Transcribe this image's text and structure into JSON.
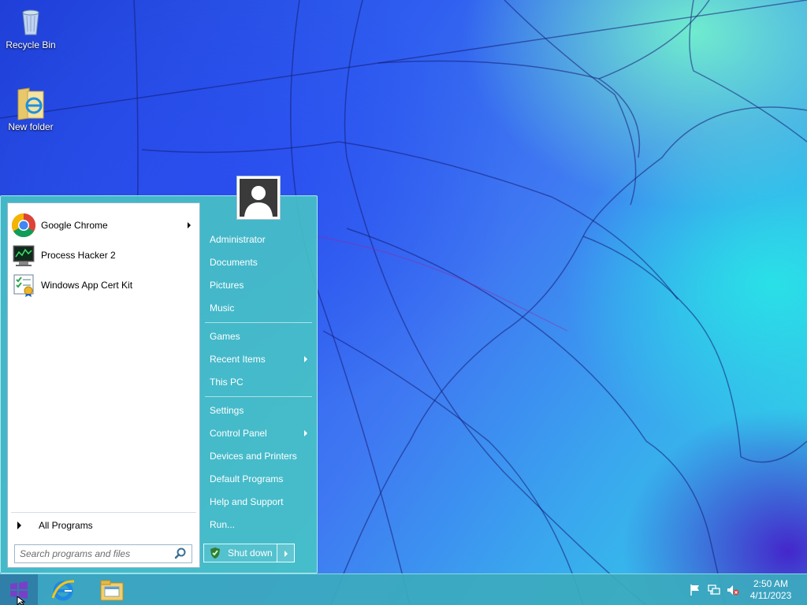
{
  "desktop": {
    "icons": [
      {
        "label": "Recycle Bin",
        "icon": "recycle-bin-icon"
      },
      {
        "label": "New folder",
        "icon": "folder-icon"
      }
    ]
  },
  "start_menu": {
    "programs": [
      {
        "label": "Google Chrome",
        "icon": "chrome-icon",
        "has_submenu": true
      },
      {
        "label": "Process Hacker 2",
        "icon": "process-hacker-icon",
        "has_submenu": false
      },
      {
        "label": "Windows App Cert Kit",
        "icon": "app-cert-kit-icon",
        "has_submenu": false
      }
    ],
    "all_programs_label": "All Programs",
    "search": {
      "placeholder": "Search programs and files",
      "value": ""
    },
    "right_column": [
      {
        "label": "Administrator",
        "has_submenu": false
      },
      {
        "label": "Documents",
        "has_submenu": false
      },
      {
        "label": "Pictures",
        "has_submenu": false
      },
      {
        "label": "Music",
        "has_submenu": false
      },
      {
        "label": "Games",
        "has_submenu": false
      },
      {
        "label": "Recent Items",
        "has_submenu": true
      },
      {
        "label": "This PC",
        "has_submenu": false
      },
      {
        "label": "Settings",
        "has_submenu": false
      },
      {
        "label": "Control Panel",
        "has_submenu": true
      },
      {
        "label": "Devices and Printers",
        "has_submenu": false
      },
      {
        "label": "Default Programs",
        "has_submenu": false
      },
      {
        "label": "Help and Support",
        "has_submenu": false
      },
      {
        "label": "Run...",
        "has_submenu": false
      }
    ],
    "shutdown_label": "Shut down"
  },
  "taskbar": {
    "pinned": [
      {
        "name": "internet-explorer-icon"
      },
      {
        "name": "file-explorer-icon"
      }
    ],
    "tray": [
      "action-center-flag-icon",
      "network-icon",
      "volume-muted-icon"
    ],
    "clock": {
      "time": "2:50 AM",
      "date": "4/11/2023"
    }
  },
  "colors": {
    "start_menu_bg": "#48c6c4",
    "taskbar_bg": "#3caabe",
    "start_logo": "#7a3fc8"
  }
}
